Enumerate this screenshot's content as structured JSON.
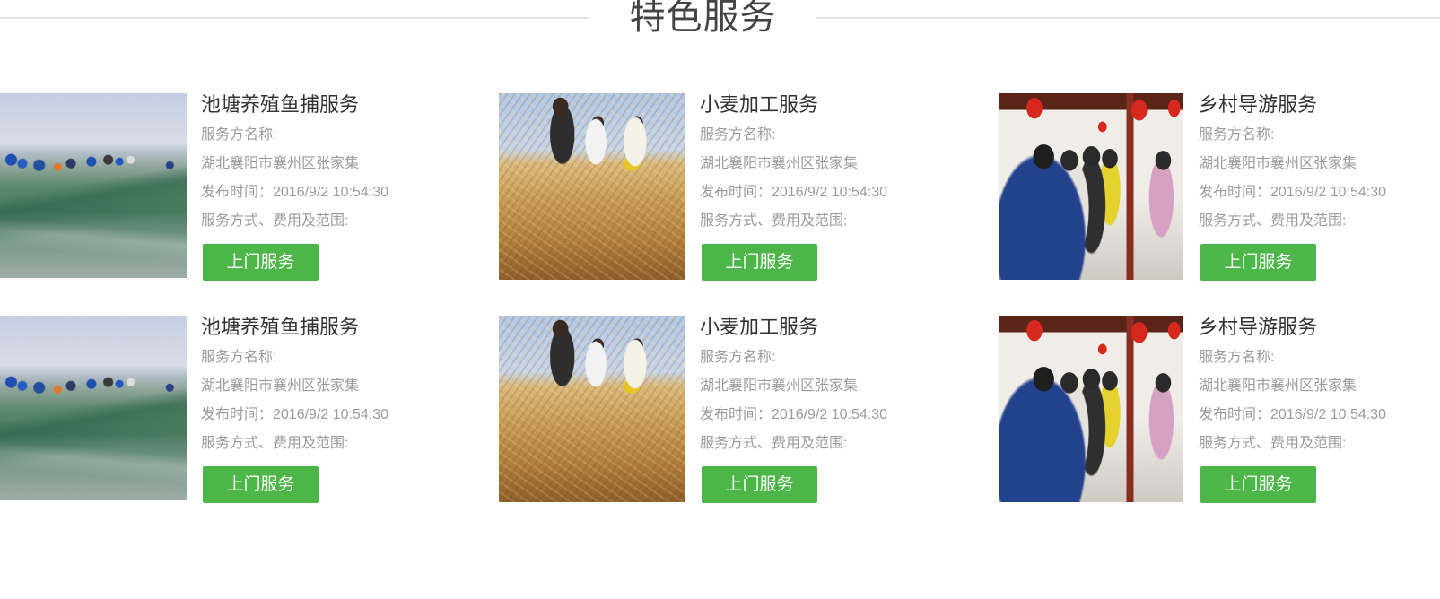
{
  "section": {
    "title": "特色服务"
  },
  "colors": {
    "accent": "#4cb748",
    "title_text": "#333333",
    "muted_text": "#9b9b9b",
    "divider": "#e2e2e2"
  },
  "services": [
    {
      "title": "池塘养殖鱼捕服务",
      "provider_label": "服务方名称:",
      "location": "湖北襄阳市襄州区张家集",
      "publish_time": "发布时间：2016/9/2 10:54:30",
      "method_label": "服务方式、费用及范围:",
      "button_label": "上门服务"
    },
    {
      "title": "小麦加工服务",
      "provider_label": "服务方名称:",
      "location": "湖北襄阳市襄州区张家集",
      "publish_time": "发布时间：2016/9/2 10:54:30",
      "method_label": "服务方式、费用及范围:",
      "button_label": "上门服务"
    },
    {
      "title": "乡村导游服务",
      "provider_label": "服务方名称:",
      "location": "湖北襄阳市襄州区张家集",
      "publish_time": "发布时间：2016/9/2 10:54:30",
      "method_label": "服务方式、费用及范围:",
      "button_label": "上门服务"
    },
    {
      "title": "池塘养殖鱼捕服务",
      "provider_label": "服务方名称:",
      "location": "湖北襄阳市襄州区张家集",
      "publish_time": "发布时间：2016/9/2 10:54:30",
      "method_label": "服务方式、费用及范围:",
      "button_label": "上门服务"
    },
    {
      "title": "小麦加工服务",
      "provider_label": "服务方名称:",
      "location": "湖北襄阳市襄州区张家集",
      "publish_time": "发布时间：2016/9/2 10:54:30",
      "method_label": "服务方式、费用及范围:",
      "button_label": "上门服务"
    },
    {
      "title": "乡村导游服务",
      "provider_label": "服务方名称:",
      "location": "湖北襄阳市襄州区张家集",
      "publish_time": "发布时间：2016/9/2 10:54:30",
      "method_label": "服务方式、费用及范围:",
      "button_label": "上门服务"
    }
  ]
}
